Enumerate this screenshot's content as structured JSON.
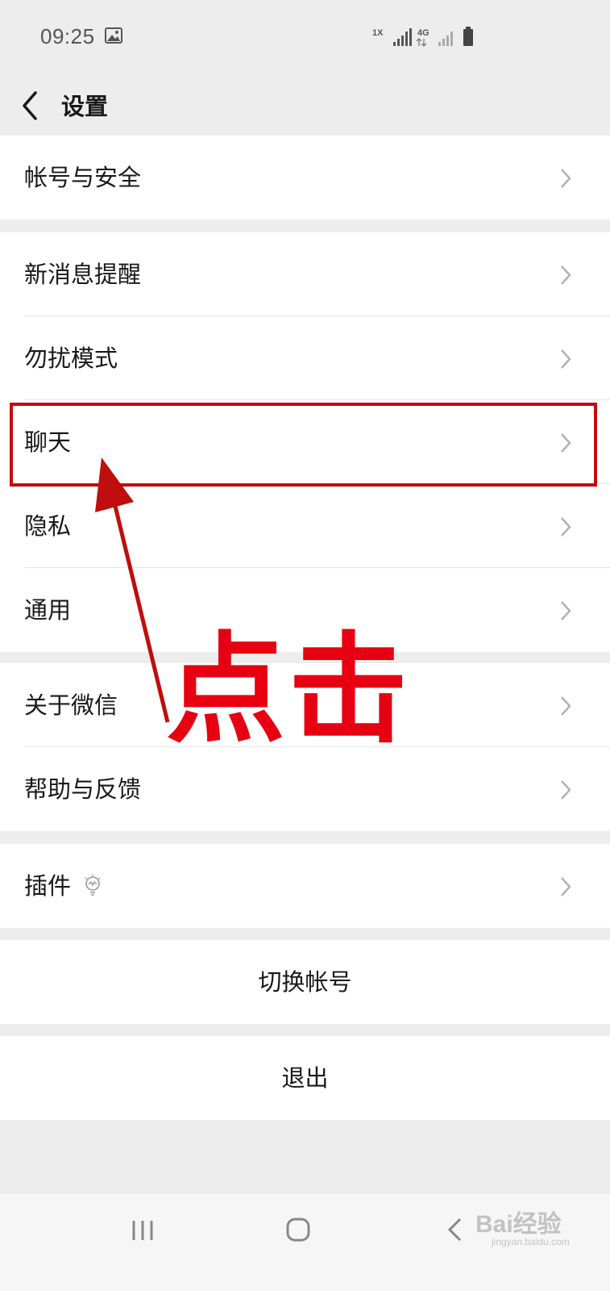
{
  "status_bar": {
    "time": "09:25",
    "net_rate": "1X",
    "net_type": "4G"
  },
  "nav": {
    "title": "设置"
  },
  "groups": [
    {
      "items": [
        {
          "label": "帐号与安全"
        }
      ]
    },
    {
      "items": [
        {
          "label": "新消息提醒"
        },
        {
          "label": "勿扰模式"
        },
        {
          "label": "聊天"
        },
        {
          "label": "隐私"
        },
        {
          "label": "通用"
        }
      ]
    },
    {
      "items": [
        {
          "label": "关于微信"
        },
        {
          "label": "帮助与反馈"
        }
      ]
    },
    {
      "items": [
        {
          "label": "插件"
        }
      ]
    }
  ],
  "actions": {
    "switch_account": "切换帐号",
    "logout": "退出"
  },
  "annotation": {
    "text": "点击",
    "color": "#e60012",
    "box_color": "#c00d0d"
  },
  "watermark": {
    "brand": "Bai经验",
    "sub": "jingyan.baidu.com"
  },
  "icons": [
    "image-icon",
    "signal-icon",
    "battery-icon",
    "back-icon",
    "chevron-right-icon",
    "bulb-icon",
    "recents-icon",
    "home-icon",
    "nav-back-icon"
  ]
}
